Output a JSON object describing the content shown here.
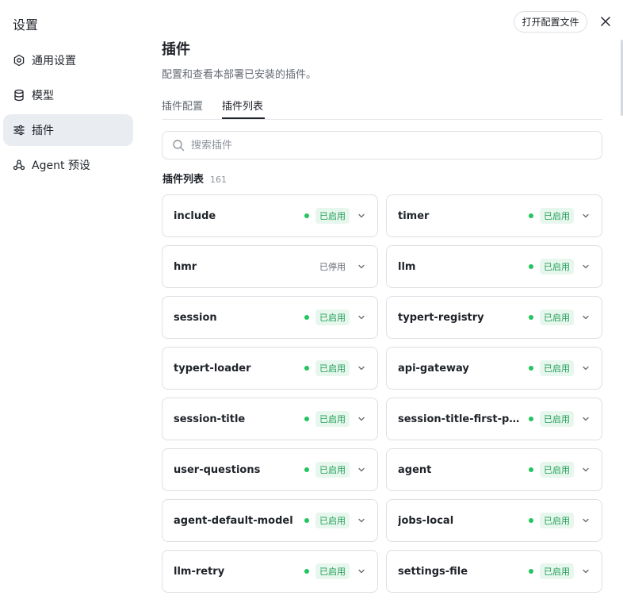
{
  "app": {
    "title": "设置"
  },
  "sidebar": {
    "items": [
      {
        "label": "通用设置",
        "icon": "gear-icon",
        "active": false
      },
      {
        "label": "模型",
        "icon": "database-icon",
        "active": false
      },
      {
        "label": "插件",
        "icon": "sliders-icon",
        "active": true
      },
      {
        "label": "Agent 预设",
        "icon": "agent-icon",
        "active": false
      }
    ]
  },
  "header": {
    "open_config_label": "打开配置文件",
    "close_icon": "close-icon"
  },
  "main": {
    "title": "插件",
    "description": "配置和查看本部署已安装的插件。",
    "tabs": [
      {
        "label": "插件配置",
        "active": false
      },
      {
        "label": "插件列表",
        "active": true
      }
    ],
    "search": {
      "placeholder": "搜索插件",
      "value": ""
    },
    "list": {
      "title": "插件列表",
      "count": "161",
      "plugins": [
        {
          "name": "include",
          "status": "已启用",
          "enabled": true
        },
        {
          "name": "timer",
          "status": "已启用",
          "enabled": true
        },
        {
          "name": "hmr",
          "status": "已停用",
          "enabled": false
        },
        {
          "name": "llm",
          "status": "已启用",
          "enabled": true
        },
        {
          "name": "session",
          "status": "已启用",
          "enabled": true
        },
        {
          "name": "typert-registry",
          "status": "已启用",
          "enabled": true
        },
        {
          "name": "typert-loader",
          "status": "已启用",
          "enabled": true
        },
        {
          "name": "api-gateway",
          "status": "已启用",
          "enabled": true
        },
        {
          "name": "session-title",
          "status": "已启用",
          "enabled": true
        },
        {
          "name": "session-title-first-pro...",
          "status": "已启用",
          "enabled": true
        },
        {
          "name": "user-questions",
          "status": "已启用",
          "enabled": true
        },
        {
          "name": "agent",
          "status": "已启用",
          "enabled": true
        },
        {
          "name": "agent-default-model",
          "status": "已启用",
          "enabled": true
        },
        {
          "name": "jobs-local",
          "status": "已启用",
          "enabled": true
        },
        {
          "name": "llm-retry",
          "status": "已启用",
          "enabled": true
        },
        {
          "name": "settings-file",
          "status": "已启用",
          "enabled": true
        }
      ]
    }
  },
  "colors": {
    "enabled": "#22c55e",
    "enabled_badge_bg": "#e8f7ee",
    "active_nav_bg": "#e9ecf0"
  }
}
